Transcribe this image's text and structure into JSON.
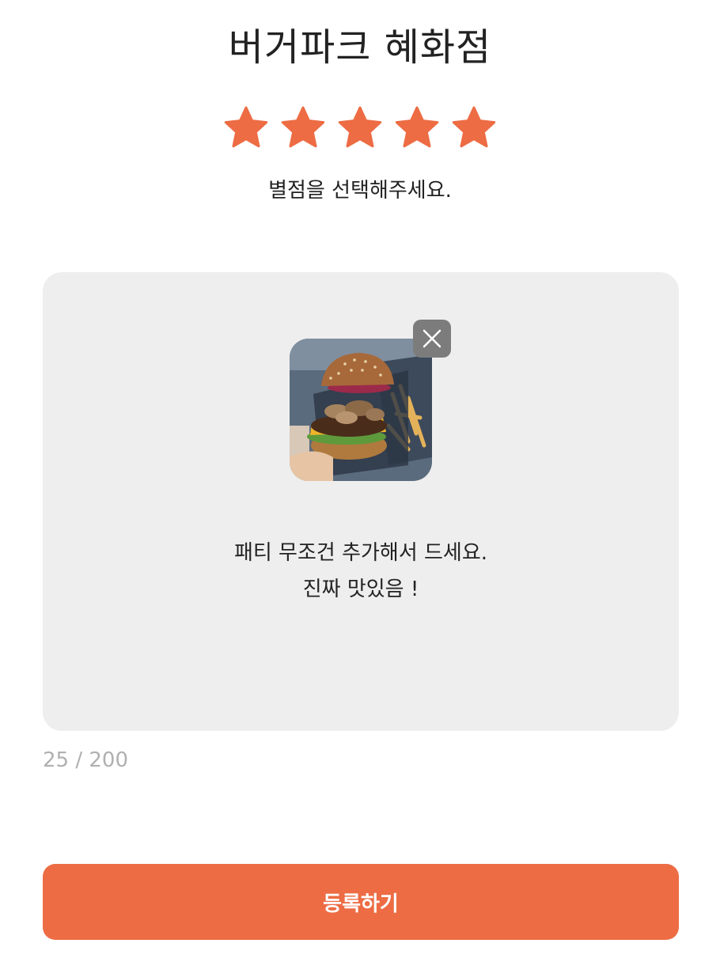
{
  "store": {
    "name": "버거파크 혜화점"
  },
  "rating": {
    "max": 5,
    "selected": 5,
    "prompt": "별점을 선택해주세요.",
    "star_color": "#ed6c44",
    "star_icon": "star-icon"
  },
  "review": {
    "photo": {
      "description": "burger-photo",
      "remove_icon": "close-icon"
    },
    "text_lines": [
      "패티 무조건 추가해서 드세요.",
      "진짜 맛있음 !"
    ],
    "char_count": "25",
    "char_separator": "/",
    "char_limit": "200",
    "char_count_display": "25 / 200"
  },
  "actions": {
    "submit_label": "등록하기"
  },
  "colors": {
    "accent": "#ed6c44",
    "box_background": "#eeeeee",
    "muted_text": "#b0b0b0",
    "remove_button": "#7c7c7c"
  }
}
